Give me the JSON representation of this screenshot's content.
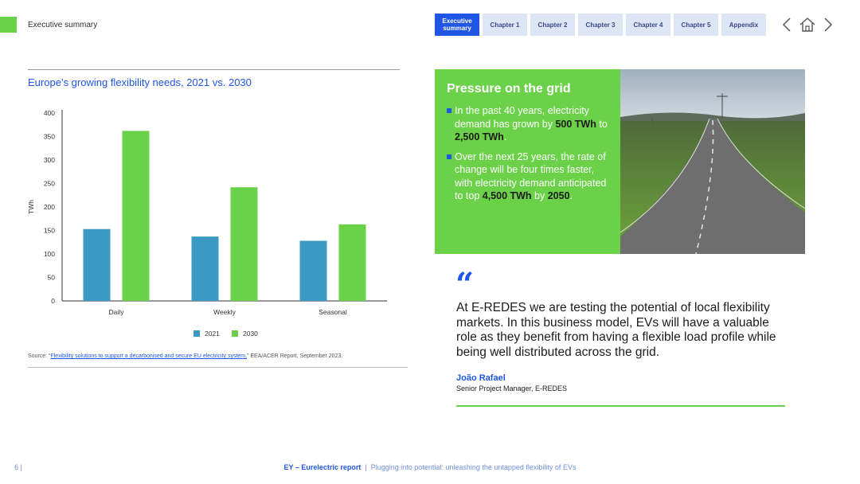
{
  "header": {
    "section_title": "Executive summary",
    "nav_tabs": [
      {
        "label": "Executive summary",
        "active": true
      },
      {
        "label": "Chapter 1",
        "active": false
      },
      {
        "label": "Chapter 2",
        "active": false
      },
      {
        "label": "Chapter 3",
        "active": false
      },
      {
        "label": "Chapter 4",
        "active": false
      },
      {
        "label": "Chapter 5",
        "active": false
      },
      {
        "label": "Appendix",
        "active": false
      }
    ],
    "icons": [
      "chevron-left-icon",
      "home-icon",
      "chevron-right-icon"
    ]
  },
  "chart": {
    "title": "Europe’s growing flexibility needs, 2021 vs. 2030",
    "source_prefix": "Source: “",
    "source_link": "Flexibility solutions to support a decarbonised and secure EU electricity system,",
    "source_suffix": "” EEA/ACER Report, September 2023."
  },
  "chart_data": {
    "type": "bar",
    "title": "Europe’s growing flexibility needs, 2021 vs. 2030",
    "categories": [
      "Daily",
      "Weekly",
      "Seasonal"
    ],
    "series": [
      {
        "name": "2021",
        "values": [
          153,
          137,
          128
        ],
        "color": "#3b9ac4"
      },
      {
        "name": "2030",
        "values": [
          362,
          242,
          163
        ],
        "color": "#6bd149"
      }
    ],
    "xlabel": "",
    "ylabel": "TWh",
    "ylim": [
      0,
      400
    ],
    "yticks": [
      0,
      50,
      100,
      150,
      200,
      250,
      300,
      350,
      400
    ],
    "grid": false,
    "legend": "bottom"
  },
  "callout": {
    "title": "Pressure on the grid",
    "bullet1_a": "In the past 40 years, electricity demand has grown by ",
    "bullet1_b": "500 TWh",
    "bullet1_c": " to ",
    "bullet1_d": "2,500 TWh",
    "bullet1_e": ".",
    "bullet2_a": "Over the next 25 years, the rate of change will be four times faster, with electricity demand anticipated to top ",
    "bullet2_b": "4,500 TWh",
    "bullet2_c": " by ",
    "bullet2_d": "2050",
    "bullet2_e": "."
  },
  "quote": {
    "mark": "“",
    "text": "At E-REDES we are testing the potential of local flexibility markets. In this business model, EVs will have a valuable role as they benefit from having a flexible load profile while being well distributed across the grid.",
    "author": "João Rafael",
    "role": "Senior Project Manager, E-REDES"
  },
  "footer": {
    "page": "6  |",
    "brand": "EY – Eurelectric report",
    "separator": "  |  ",
    "subtitle": "Plugging into potential: unleashing the untapped flexibility of EVs"
  },
  "colors": {
    "accent_blue": "#1f56e6",
    "accent_green": "#6bd149",
    "bar_2021": "#3b9ac4"
  }
}
